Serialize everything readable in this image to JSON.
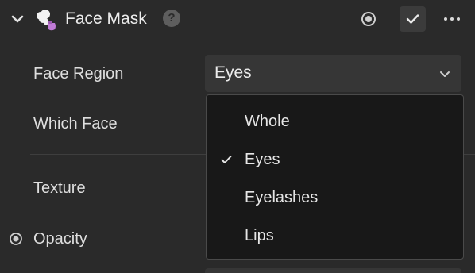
{
  "header": {
    "title": "Face Mask",
    "help_glyph": "?",
    "icons": {
      "collapse": "chevron-down-icon",
      "plugin": "face-mask-icon",
      "record": "record-icon",
      "check": "check-icon",
      "more": "more-icon"
    }
  },
  "fields": {
    "face_region_label": "Face Region",
    "which_face_label": "Which Face",
    "texture_label": "Texture",
    "opacity_label": "Opacity"
  },
  "face_region_select": {
    "value": "Eyes",
    "options": [
      "Whole",
      "Eyes",
      "Eyelashes",
      "Lips"
    ],
    "selected_index": 1
  },
  "colors": {
    "background": "#2a2a2a",
    "menu_background": "#181818",
    "select_background": "#363636",
    "plugin_accent": "#c07bd6"
  }
}
